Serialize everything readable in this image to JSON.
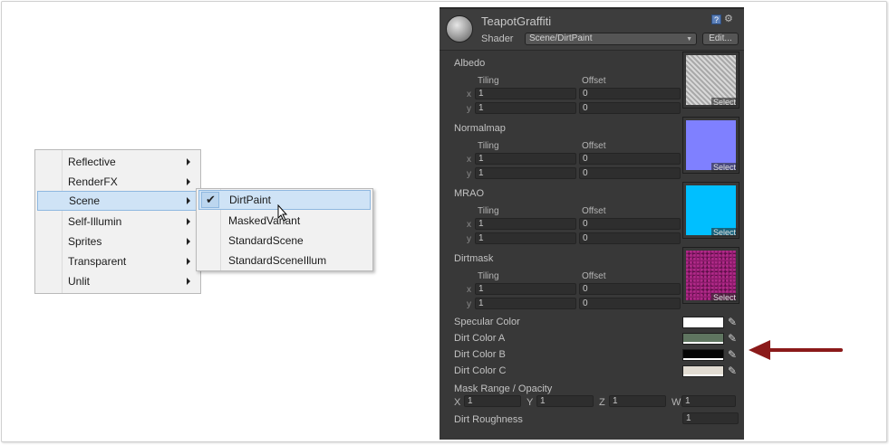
{
  "context_menu": {
    "items": [
      {
        "label": "Reflective",
        "has_submenu": true
      },
      {
        "label": "RenderFX",
        "has_submenu": true
      },
      {
        "label": "Scene",
        "has_submenu": true,
        "highlighted": true
      },
      {
        "label": "Self-Illumin",
        "has_submenu": true
      },
      {
        "label": "Sprites",
        "has_submenu": true
      },
      {
        "label": "Transparent",
        "has_submenu": true
      },
      {
        "label": "Unlit",
        "has_submenu": true
      }
    ]
  },
  "submenu": {
    "items": [
      {
        "label": "DirtPaint",
        "checked": true,
        "highlighted": true
      },
      {
        "label": "MaskedVariant"
      },
      {
        "label": "StandardScene"
      },
      {
        "label": "StandardSceneIllum"
      }
    ]
  },
  "inspector": {
    "material_name": "TeapotGraffiti",
    "shader_label": "Shader",
    "shader_value": "Scene/DirtPaint",
    "edit_label": "Edit...",
    "tiling_label": "Tiling",
    "offset_label": "Offset",
    "select_label": "Select",
    "axis_x": "x",
    "axis_y": "y",
    "textures": [
      {
        "name": "Albedo",
        "tiling_x": "1",
        "tiling_y": "1",
        "offset_x": "0",
        "offset_y": "0",
        "preview_color": "#bdbdbd"
      },
      {
        "name": "Normalmap",
        "tiling_x": "1",
        "tiling_y": "1",
        "offset_x": "0",
        "offset_y": "0",
        "preview_color": "#7f80ff"
      },
      {
        "name": "MRAO",
        "tiling_x": "1",
        "tiling_y": "1",
        "offset_x": "0",
        "offset_y": "0",
        "preview_color": "#00bfff"
      },
      {
        "name": "Dirtmask",
        "tiling_x": "1",
        "tiling_y": "1",
        "offset_x": "0",
        "offset_y": "0",
        "preview_color": "#8e1a6d"
      }
    ],
    "colors": [
      {
        "name": "Specular Color",
        "value": "#ffffff"
      },
      {
        "name": "Dirt Color A",
        "value": "#5f7560"
      },
      {
        "name": "Dirt Color B",
        "value": "#050505"
      },
      {
        "name": "Dirt Color C",
        "value": "#e2dcd2"
      }
    ],
    "mask_range_label": "Mask Range / Opacity",
    "vector": [
      {
        "axis": "X",
        "value": "1"
      },
      {
        "axis": "Y",
        "value": "1"
      },
      {
        "axis": "Z",
        "value": "1"
      },
      {
        "axis": "W",
        "value": "1"
      }
    ],
    "roughness_label": "Dirt Roughness",
    "roughness_value": "1"
  },
  "annotation": {
    "arrow_color": "#8b1a1a"
  }
}
